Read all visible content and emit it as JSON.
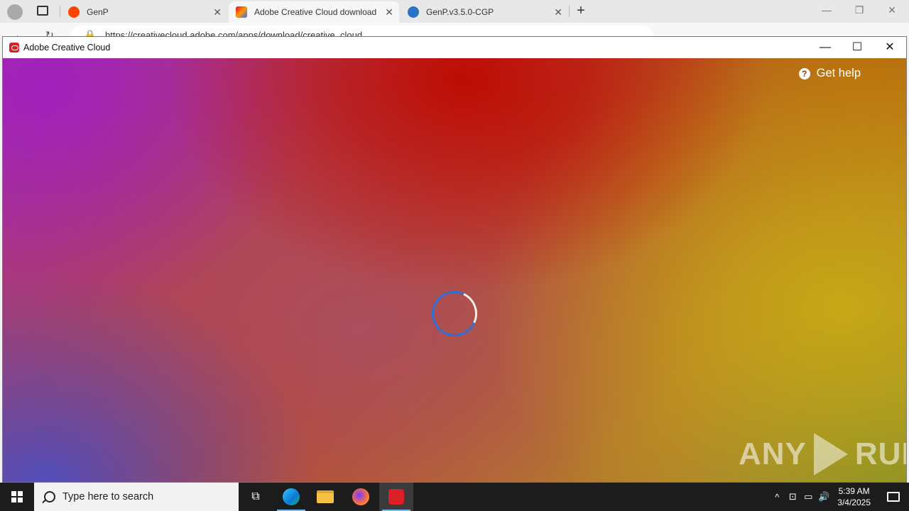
{
  "browser": {
    "tabs": [
      {
        "label": "GenP",
        "icon": "reddit-icon",
        "active": false
      },
      {
        "label": "Adobe Creative Cloud download",
        "icon": "creative-cloud-icon",
        "active": true
      },
      {
        "label": "GenP.v3.5.0-CGP",
        "icon": "site-icon",
        "active": false
      }
    ],
    "address": "https://creativecloud.adobe.com/apps/download/creative_cloud"
  },
  "app": {
    "title": "Adobe Creative Cloud",
    "help_label": "Get help",
    "help_icon": "?",
    "state": "loading"
  },
  "watermark": {
    "left": "ANY",
    "right": "RUN"
  },
  "taskbar": {
    "search_placeholder": "Type here to search",
    "apps": [
      "task-view",
      "edge",
      "file-explorer",
      "firefox",
      "creative-cloud"
    ],
    "time": "5:39 AM",
    "date": "3/4/2025"
  },
  "colors": {
    "accent_red": "#da1f26",
    "spinner_blue": "#2f6fd6",
    "taskbar": "#1c1c1c"
  }
}
